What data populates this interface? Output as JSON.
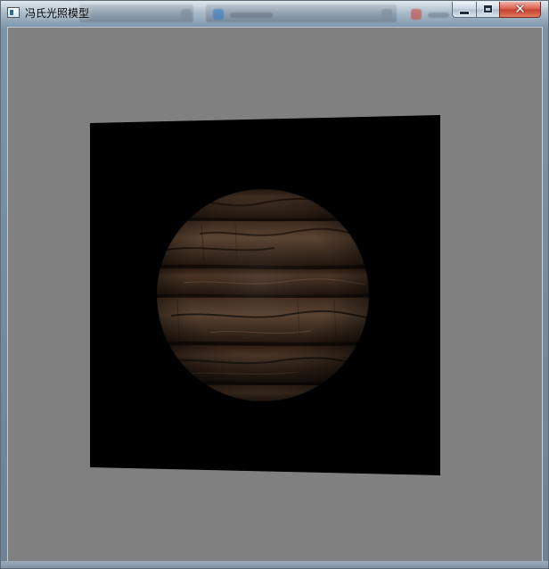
{
  "window": {
    "title": "冯氏光照模型"
  },
  "caption_buttons": [
    {
      "name": "minimize",
      "icon": "minimize-icon"
    },
    {
      "name": "maximize",
      "icon": "maximize-icon"
    },
    {
      "name": "close",
      "icon": "close-icon",
      "glyph": "✕"
    }
  ],
  "scene": {
    "background_color": "#808080",
    "plane_color": "#000000",
    "sphere_texture": "wood-plank-texture",
    "sphere_base_color": "#3d2b1f"
  }
}
